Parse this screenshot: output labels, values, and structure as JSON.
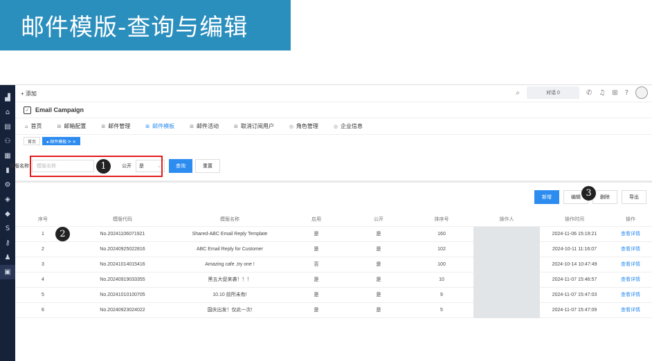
{
  "slide_title": "邮件模版-查询与编辑",
  "topbar": {
    "add_label": "+ 添加",
    "dialog_label": "对话",
    "dialog_count": "0"
  },
  "app": {
    "name": "Email Campaign"
  },
  "nav": [
    "首页",
    "邮箱配置",
    "邮件管理",
    "邮件模板",
    "邮件活动",
    "取消订阅用户",
    "角色管理",
    "企业信息"
  ],
  "tabs": {
    "home": "首页",
    "current": "● 邮件模板 ⟳ ✕"
  },
  "filter": {
    "name_label": "模版名称",
    "name_placeholder": "模版名称",
    "public_label": "公开",
    "public_value": "是",
    "search_button": "查询",
    "reset_button": "重置"
  },
  "actions": {
    "add": "新增",
    "edit": "编辑",
    "delete": "删除",
    "export": "导出"
  },
  "badges": [
    "1",
    "2",
    "3"
  ],
  "table": {
    "headers": [
      "序号",
      "模版代码",
      "模版名称",
      "启用",
      "公开",
      "排序号",
      "操作人",
      "操作时间",
      "操作"
    ],
    "rows": [
      {
        "no": "1",
        "code": "No.20241106071921",
        "name": "Shared-ABC Email Reply Template",
        "enabled": "是",
        "public": "是",
        "order": "160",
        "operator": "",
        "time": "2024-11-06 15:19:21",
        "op": "查看详情"
      },
      {
        "no": "2",
        "code": "No.20240925022816",
        "name": "ABC Email Reply for Customer",
        "enabled": "是",
        "public": "是",
        "order": "102",
        "operator": "",
        "time": "2024-10-11 11:16:07",
        "op": "查看详情"
      },
      {
        "no": "3",
        "code": "No.20241014015416",
        "name": "Amazing cafe ,try one !",
        "enabled": "否",
        "public": "是",
        "order": "100",
        "operator": "",
        "time": "2024-10-14 10:47:49",
        "op": "查看详情"
      },
      {
        "no": "4",
        "code": "No.20240919033355",
        "name": "黑五大促来袭！！！",
        "enabled": "是",
        "public": "是",
        "order": "10",
        "operator": "",
        "time": "2024-11-07 15:46:57",
        "op": "查看详情"
      },
      {
        "no": "5",
        "code": "No.20241010100705",
        "name": "10.10 前所未有!",
        "enabled": "是",
        "public": "是",
        "order": "9",
        "operator": "",
        "time": "2024-11-07 15:47:03",
        "op": "查看详情"
      },
      {
        "no": "6",
        "code": "No.20240923024022",
        "name": "国庆出发！仅此一次!",
        "enabled": "是",
        "public": "是",
        "order": "5",
        "operator": "",
        "time": "2024-11-07 15:47:09",
        "op": "查看详情"
      }
    ]
  }
}
